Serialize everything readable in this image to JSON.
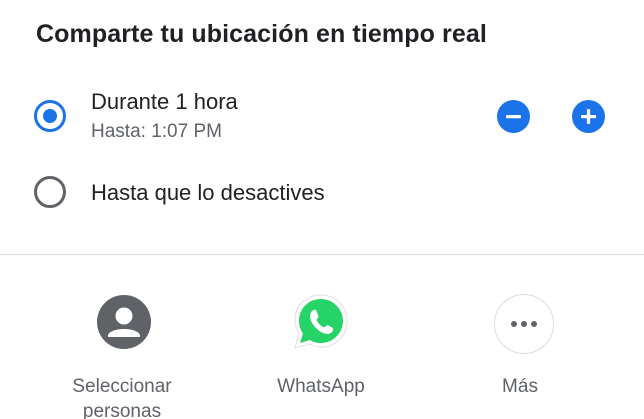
{
  "dialog": {
    "title": "Comparte tu ubicación en tiempo real"
  },
  "duration_options": [
    {
      "label": "Durante 1 hora",
      "sublabel": "Hasta: 1:07 PM",
      "selected": true
    },
    {
      "label": "Hasta que lo desactives",
      "selected": false
    }
  ],
  "controls": {
    "decrease_icon": "minus-circle-icon",
    "increase_icon": "plus-circle-icon"
  },
  "share_targets": [
    {
      "label": "Seleccionar personas",
      "icon": "person-circle-icon"
    },
    {
      "label": "WhatsApp",
      "icon": "whatsapp-icon"
    },
    {
      "label": "Más",
      "icon": "more-horiz-icon"
    }
  ],
  "colors": {
    "accent": "#1a73e8",
    "whatsapp_green": "#25d366",
    "text_primary": "#202124",
    "text_secondary": "#5f6368",
    "divider": "#dadce0"
  }
}
